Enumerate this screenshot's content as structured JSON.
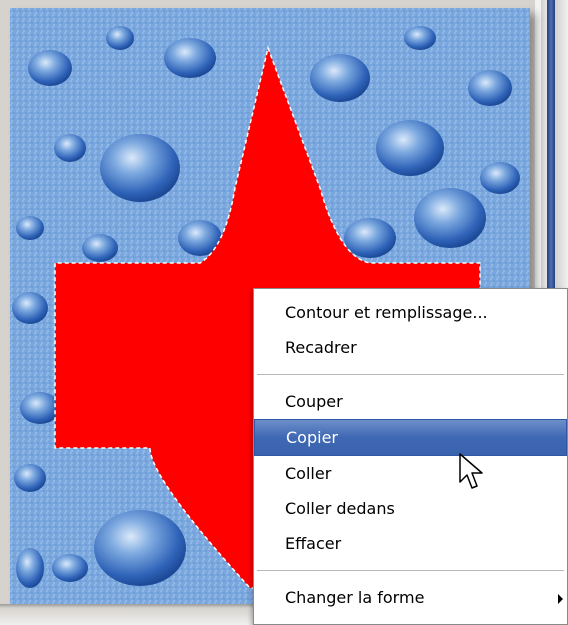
{
  "canvas": {
    "background_color": "#6f9fd8",
    "shape_color": "#ff0000",
    "selection_style": "dashed-marquee"
  },
  "context_menu": {
    "items": [
      {
        "label": "Contour et remplissage..."
      },
      {
        "label": "Recadrer"
      },
      {
        "label": "Couper"
      },
      {
        "label": "Copier",
        "highlighted": true
      },
      {
        "label": "Coller"
      },
      {
        "label": "Coller dedans"
      },
      {
        "label": "Effacer"
      },
      {
        "label": "Changer la forme",
        "submenu": true
      }
    ],
    "highlight_color": "#3f68b4"
  },
  "cursor": {
    "icon": "arrow-cursor-icon"
  }
}
